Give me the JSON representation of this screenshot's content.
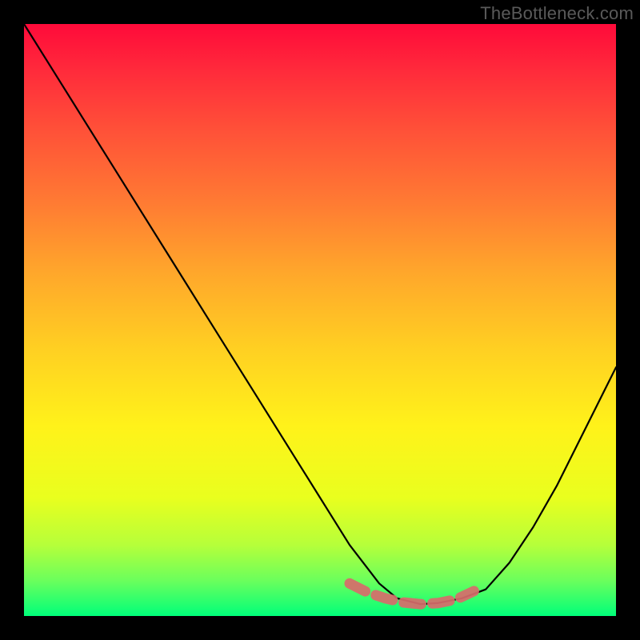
{
  "watermark": "TheBottleneck.com",
  "colors": {
    "curve": "#000000",
    "highlight": "#d86b6b",
    "frame": "#000000"
  },
  "chart_data": {
    "type": "line",
    "title": "",
    "xlabel": "",
    "ylabel": "",
    "xlim": [
      0,
      100
    ],
    "ylim": [
      0,
      100
    ],
    "series": [
      {
        "name": "bottleneck-curve",
        "x": [
          0,
          5,
          10,
          15,
          20,
          25,
          30,
          35,
          40,
          45,
          50,
          55,
          60,
          63,
          67,
          70,
          74,
          78,
          82,
          86,
          90,
          94,
          98,
          100
        ],
        "values": [
          100,
          92,
          84,
          76,
          68,
          60,
          52,
          44,
          36,
          28,
          20,
          12,
          5.5,
          3.0,
          2.0,
          2.2,
          3.0,
          4.5,
          9,
          15,
          22,
          30,
          38,
          42
        ]
      },
      {
        "name": "highlight-band",
        "x": [
          55,
          58,
          61,
          64,
          67,
          70,
          73,
          76
        ],
        "values": [
          5.5,
          4.0,
          3.0,
          2.3,
          2.0,
          2.2,
          2.8,
          4.2
        ]
      }
    ],
    "grid": false,
    "legend": false
  }
}
